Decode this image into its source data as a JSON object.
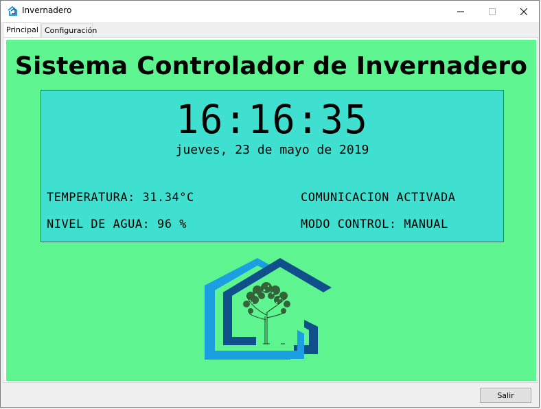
{
  "window": {
    "title": "Invernadero",
    "icon": "greenhouse-app-icon",
    "controls": [
      "minimize-icon",
      "maximize-icon",
      "close-icon"
    ]
  },
  "tabs": [
    {
      "label": "Principal",
      "active": true
    },
    {
      "label": "Configuración",
      "active": false
    }
  ],
  "main": {
    "title": "Sistema Controlador de Invernadero",
    "clock": "16:16:35",
    "date": "jueves, 23 de mayo de 2019",
    "temperature": "TEMPERATURA: 31.34°C",
    "water_level": "NIVEL DE AGUA:  96 %",
    "communication": "COMUNICACION ACTIVADA",
    "control_mode": "MODO CONTROL: MANUAL",
    "logo": "greenhouse-tree-logo"
  },
  "footer": {
    "exit_label": "Salir"
  },
  "colors": {
    "panel_bg": "#5ef591",
    "display_bg": "#40e0d0",
    "logo_light_blue": "#1c9fe0",
    "logo_dark_blue": "#0f4f8a"
  }
}
